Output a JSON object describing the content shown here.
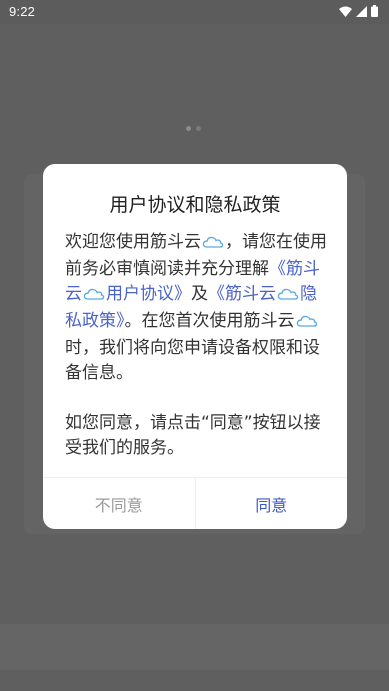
{
  "status_bar": {
    "time": "9:22",
    "icons": [
      "wifi-icon",
      "signal-icon",
      "battery-icon"
    ]
  },
  "dialog": {
    "title": "用户协议和隐私政策",
    "body": {
      "p1_intro": "欢迎您使用筋斗云",
      "p1_after_cloud": "，请您在使用前务必审慎阅读并充分理解",
      "link_user_open": "《筋斗云",
      "link_user_close": "用户协议》",
      "and": "及",
      "link_privacy_open": "《筋斗云",
      "link_privacy_close": "隐私政策》",
      "p1_continue": "。在您首次使用筋斗云",
      "p1_end": "时，我们将向您申请设备权限和设备信息。",
      "p2": "如您同意，请点击“同意”按钮以接受我们的服务。"
    },
    "buttons": {
      "disagree": "不同意",
      "agree": "同意"
    }
  },
  "colors": {
    "overlay": "#5f5f5f",
    "link": "#4a63c9",
    "agree": "#3d57c4",
    "disagree": "#9a9a9a",
    "cloud_icon": "#5aa9e6"
  }
}
